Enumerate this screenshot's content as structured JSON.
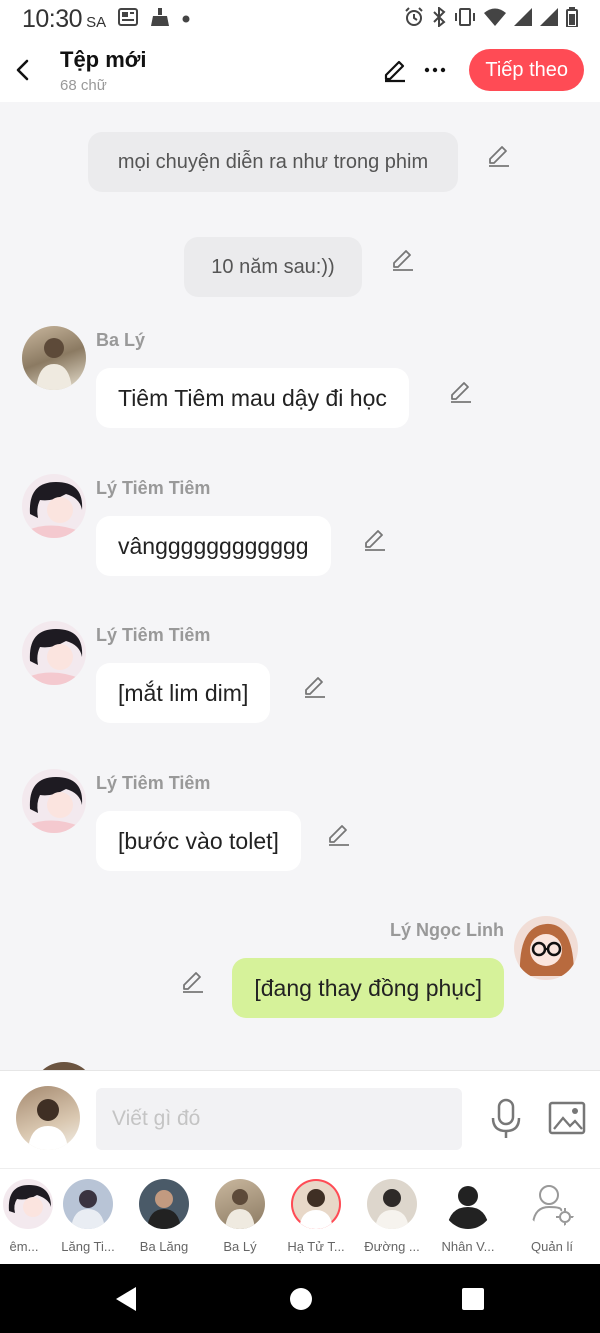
{
  "status": {
    "time": "10:30",
    "ampm": "SA"
  },
  "header": {
    "title": "Tệp mới",
    "subtitle": "68 chữ",
    "next_label": "Tiếp theo"
  },
  "colors": {
    "accent": "#ff4b55",
    "me_bubble": "#d6f29a",
    "bg": "#f5f5f7"
  },
  "messages": [
    {
      "type": "narration",
      "text": "mọi chuyện diễn ra như trong phim"
    },
    {
      "type": "narration",
      "text": "10 năm sau:))"
    },
    {
      "type": "left",
      "name": "Ba Lý",
      "text": "Tiêm Tiêm mau dậy đi học"
    },
    {
      "type": "left",
      "name": "Lý Tiêm Tiêm",
      "text": "vângggggggggggg"
    },
    {
      "type": "left",
      "name": "Lý Tiêm Tiêm",
      "text": "[mắt lim dim]"
    },
    {
      "type": "left",
      "name": "Lý Tiêm Tiêm",
      "text": "[bước vào tolet]"
    },
    {
      "type": "right",
      "name": "Lý Ngọc Linh",
      "text": "[đang thay đồng phục]"
    }
  ],
  "input": {
    "placeholder": "Viết gì đó"
  },
  "characters": [
    {
      "label": "êm..."
    },
    {
      "label": "Lăng Ti..."
    },
    {
      "label": "Ba Lăng"
    },
    {
      "label": "Ba Lý"
    },
    {
      "label": "Hạ Tử T..."
    },
    {
      "label": "Đường ..."
    },
    {
      "label": "Nhân V..."
    },
    {
      "label": "Quản lí"
    }
  ]
}
